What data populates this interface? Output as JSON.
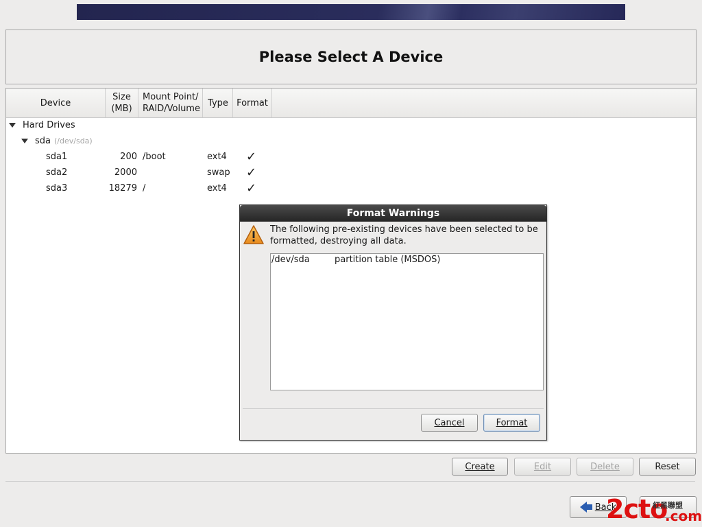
{
  "page": {
    "title": "Please Select A Device"
  },
  "table": {
    "columns": {
      "device": "Device",
      "size_line1": "Size",
      "size_line2": "(MB)",
      "mount_line1": "Mount Point/",
      "mount_line2": "RAID/Volume",
      "type": "Type",
      "format": "Format"
    },
    "group": "Hard Drives",
    "disk": {
      "name": "sda",
      "path": "(/dev/sda)"
    },
    "rows": [
      {
        "device": "sda1",
        "size": "200",
        "mount": "/boot",
        "type": "ext4",
        "format": "✓"
      },
      {
        "device": "sda2",
        "size": "2000",
        "mount": "",
        "type": "swap",
        "format": "✓"
      },
      {
        "device": "sda3",
        "size": "18279",
        "mount": "/",
        "type": "ext4",
        "format": "✓"
      }
    ]
  },
  "dialog": {
    "title": "Format Warnings",
    "message": "The following pre-existing devices have been selected to be formatted, destroying all data.",
    "devices": [
      {
        "path": "/dev/sda",
        "desc": "partition table (MSDOS)"
      }
    ],
    "cancel_label": "Cancel",
    "format_label": "Format",
    "icon": "warning-icon"
  },
  "actions": {
    "create": "Create",
    "edit": "Edit",
    "delete": "Delete",
    "reset": "Reset"
  },
  "nav": {
    "back": "Back"
  },
  "watermark": {
    "brand": "2cto",
    "small": "紅黑聯盟",
    "domain": ".com"
  }
}
